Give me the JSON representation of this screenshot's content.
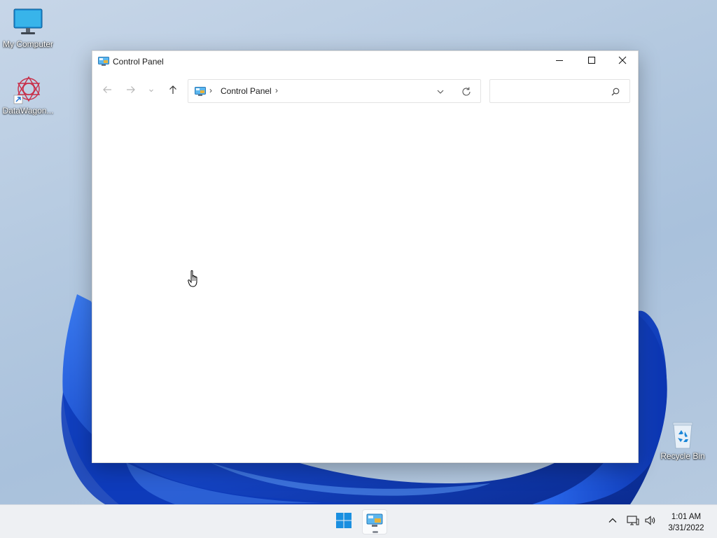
{
  "desktop": {
    "icons": [
      {
        "label": "My Computer",
        "icon": "monitor-icon"
      },
      {
        "label": "DataWagon...",
        "icon": "shortcut-app-icon"
      },
      {
        "label": "Recycle Bin",
        "icon": "recycle-bin-icon"
      }
    ]
  },
  "window": {
    "title": "Control Panel",
    "icon": "control-panel-icon",
    "controls": {
      "minimize": "minimize-icon",
      "maximize": "maximize-icon",
      "close": "close-icon"
    }
  },
  "navigation": {
    "back": "arrow-left-icon",
    "forward": "arrow-right-icon",
    "recent": "chevron-down-icon",
    "up": "arrow-up-icon"
  },
  "address_bar": {
    "separator": "›",
    "crumbs": [
      "Control Panel"
    ],
    "dropdown": "chevron-down-icon",
    "refresh": "refresh-icon"
  },
  "search": {
    "placeholder": "",
    "value": "",
    "icon": "search-icon"
  },
  "taskbar": {
    "start": "windows-start-icon",
    "pinned": [
      {
        "name": "Control Panel",
        "icon": "control-panel-icon",
        "active": true
      }
    ],
    "tray": {
      "chevron": "chevron-up-icon",
      "network": "network-icon",
      "volume": "speaker-icon"
    },
    "clock": {
      "time": "1:01 AM",
      "date": "3/31/2022"
    }
  },
  "colors": {
    "accent": "#0067c0",
    "bloom": "#1a4fd6",
    "taskbar": "#eef0f3"
  }
}
